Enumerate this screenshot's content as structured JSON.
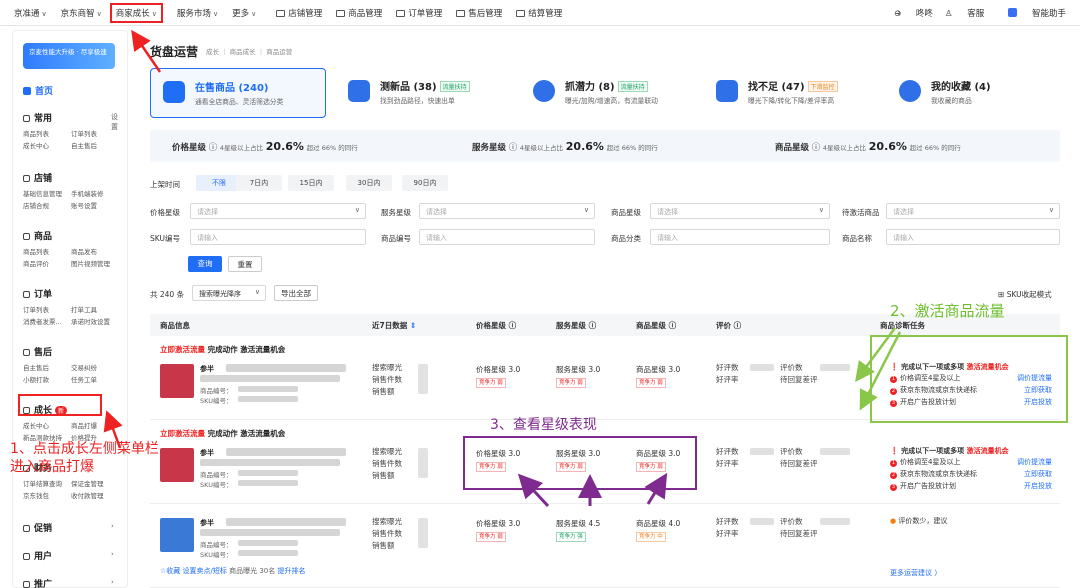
{
  "topnav": {
    "items": [
      "京准通",
      "京东商智",
      "商家成长",
      "服务市场",
      "更多"
    ],
    "links": [
      "店铺管理",
      "商品管理",
      "订单管理",
      "售后管理",
      "结算管理"
    ],
    "right": [
      "咚咚",
      "客服",
      "智能助手"
    ]
  },
  "sidebar": {
    "promo": "京麦性能大升级 · 尽享极速",
    "home": "首页",
    "sections": [
      {
        "title": "常用",
        "extra": "设置",
        "rows": [
          [
            "商品列表",
            "订单列表"
          ],
          [
            "成长中心",
            "自主售后"
          ]
        ]
      },
      {
        "title": "店铺",
        "rows": [
          [
            "基础信息管理",
            "手机端装修"
          ],
          [
            "店铺合规",
            "账号设置"
          ]
        ]
      },
      {
        "title": "商品",
        "rows": [
          [
            "商品列表",
            "商品发布"
          ],
          [
            "商品评价",
            "图片视频管理"
          ]
        ]
      },
      {
        "title": "订单",
        "rows": [
          [
            "订单列表",
            "打单工具"
          ],
          [
            "消费者发票...",
            "承诺时效设置"
          ]
        ]
      },
      {
        "title": "售后",
        "rows": [
          [
            "自主售后",
            "交易纠纷"
          ],
          [
            "小额打款",
            "任务工单"
          ]
        ]
      },
      {
        "title": "成长",
        "badge": "新",
        "rows": [
          [
            "成长中心",
            "商品打爆"
          ],
          [
            "新品测款扶持",
            "价格提升"
          ]
        ]
      },
      {
        "title": "财务",
        "rows": [
          [
            "订单结算查询",
            "保证金管理"
          ],
          [
            "京东钱包",
            "收付款管理"
          ]
        ]
      },
      {
        "title": "促销"
      },
      {
        "title": "用户"
      },
      {
        "title": "推广"
      }
    ]
  },
  "main": {
    "title": "货盘运营",
    "breadcrumb": "成长 ｜ 商品成长 ｜ 商品运营",
    "cards": [
      {
        "title": "在售商品 (240)",
        "sub": "通看全店商品、灵活筛选分类"
      },
      {
        "title": "测新品 (38)",
        "tag": "流量扶持",
        "sub": "找到劲品路径，快速出单"
      },
      {
        "title": "抓潜力 (8)",
        "tag": "流量扶持",
        "sub": "曝光/加购/增速高，有流量联动"
      },
      {
        "title": "找不足 (47)",
        "tag": "下滑监控",
        "sub": "曝光下降/转化下降/差评率高"
      },
      {
        "title": "我的收藏 (4)",
        "sub": "我收藏的商品"
      }
    ],
    "starbar": [
      {
        "label": "价格星级",
        "pre": "4星级以上占比",
        "pct": "20.6%",
        "post": "超过 66% 的同行"
      },
      {
        "label": "服务星级",
        "pre": "4星级以上占比",
        "pct": "20.6%",
        "post": "超过 66% 的同行"
      },
      {
        "label": "商品星级",
        "pre": "4星级以上占比",
        "pct": "20.6%",
        "post": "超过 66% 的同行"
      }
    ],
    "filters": {
      "time_label": "上架时间",
      "time_chips": [
        "不限",
        "7日内",
        "15日内",
        "30日内",
        "90日内"
      ],
      "labels": [
        "价格星级",
        "服务星级",
        "商品星级",
        "待激活商品",
        "SKU编号",
        "商品编号",
        "商品分类",
        "商品名称"
      ],
      "select_ph": "请选择",
      "input_ph": "请输入",
      "query": "查询",
      "reset": "重置"
    },
    "listbar": {
      "total": "共 240 条",
      "sort": "搜索曝光降序",
      "export": "导出全部",
      "sku_mode": "SKU收起模式"
    },
    "table": {
      "headers": [
        "商品信息",
        "近7日数据",
        "价格星级",
        "服务星级",
        "商品星级",
        "评价",
        "商品诊断任务"
      ],
      "rows": [
        {
          "head_red": "立即激活流量",
          "head_rest": "完成动作 激活流量机会",
          "ptitle": "参半",
          "pmeta": [
            "商品编号：",
            "SKU编号："
          ],
          "metrics": [
            "搜索曝光",
            "销售件数",
            "销售额"
          ],
          "price": "价格星级 3.0",
          "service": "服务星级 3.0",
          "product": "商品星级 3.0",
          "comp": [
            "竞争力 弱",
            "竞争力 弱",
            "竞争力 弱"
          ],
          "review": [
            "好评数",
            "好评率"
          ],
          "review2": [
            "评价数",
            "待回复差评"
          ],
          "task_title": "完成以下一项或多项",
          "task_title_red": "激活流量机会",
          "tasks": [
            [
              "价格调至4星及以上",
              "调价提流量"
            ],
            [
              "获京东物流或京东快递标",
              "立即获取"
            ],
            [
              "开启广告投放计划",
              "开启投放"
            ]
          ]
        },
        {
          "head_red": "立即激活流量",
          "head_rest": "完成动作 激活流量机会",
          "ptitle": "参半",
          "pmeta": [
            "商品编号：",
            "SKU编号："
          ],
          "metrics": [
            "搜索曝光",
            "销售件数",
            "销售额"
          ],
          "price": "价格星级 3.0",
          "service": "服务星级 3.0",
          "product": "商品星级 3.0",
          "comp": [
            "竞争力 弱",
            "竞争力 弱",
            "竞争力 弱"
          ],
          "review": [
            "好评数",
            "好评率"
          ],
          "review2": [
            "评价数",
            "待回复差评"
          ],
          "task_title": "完成以下一项或多项",
          "task_title_red": "激活流量机会",
          "tasks": [
            [
              "价格调至4星及以上",
              "调价提流量"
            ],
            [
              "获京东物流或京东快递标",
              "立即获取"
            ],
            [
              "开启广告投放计划",
              "开启投放"
            ]
          ]
        },
        {
          "ptitle": "参半",
          "pmeta": [
            "商品编号：",
            "SKU编号："
          ],
          "metrics": [
            "搜索曝光",
            "销售件数",
            "销售额"
          ],
          "price": "价格星级 3.0",
          "service": "服务星级 4.5",
          "product": "商品星级 4.0",
          "comp": [
            "竞争力 弱",
            "竞争力 强",
            "竞争力 中"
          ],
          "review": [
            "好评数",
            "好评率"
          ],
          "review2": [
            "评价数",
            "待回复差评"
          ],
          "task_note": "评价数少，建议",
          "footer_links": [
            "☆收藏",
            "设置卖点/短标",
            "商品曝光 30名",
            "提升排名"
          ],
          "more": "更多运营建议 〉"
        }
      ]
    }
  },
  "annotations": {
    "step1": "1、点击成长左侧菜单栏\n进入商品打爆",
    "step2": "2、激活商品流量",
    "step3": "3、查看星级表现"
  }
}
